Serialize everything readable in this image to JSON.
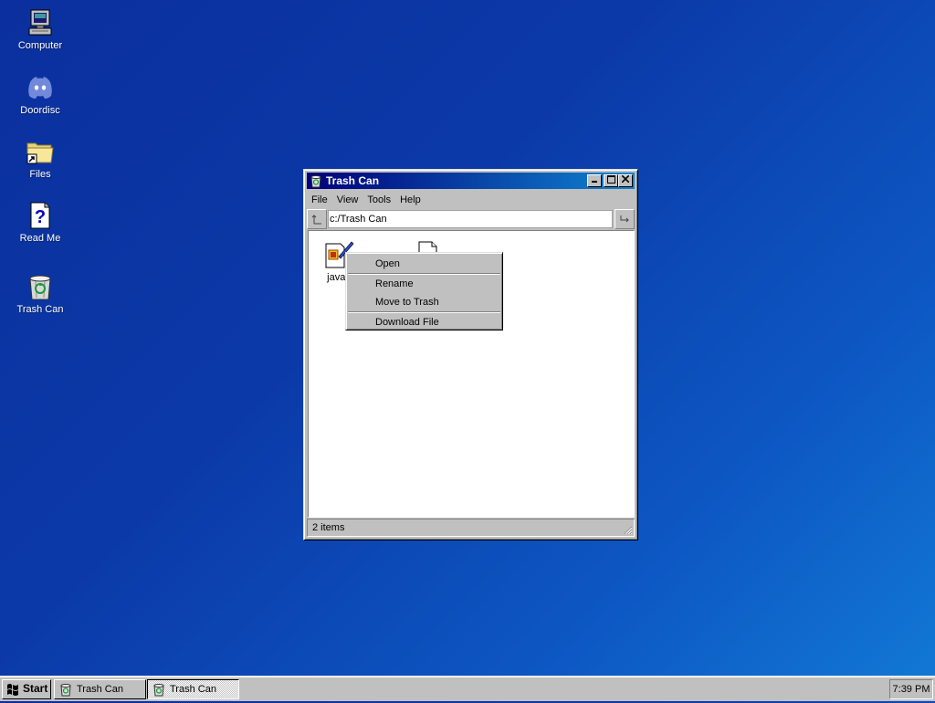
{
  "desktop": {
    "icons": [
      {
        "label": "Computer",
        "icon": "computer-icon"
      },
      {
        "label": "Doordisc",
        "icon": "discord-icon"
      },
      {
        "label": "Files",
        "icon": "folder-shortcut-icon"
      },
      {
        "label": "Read Me",
        "icon": "help-document-icon"
      },
      {
        "label": "Trash Can",
        "icon": "trash-can-icon"
      }
    ]
  },
  "window": {
    "title": "Trash Can",
    "title_icon": "trash-can-icon",
    "controls": {
      "minimize": "minimize-icon",
      "maximize": "maximize-icon",
      "close": "close-icon"
    },
    "menu": [
      "File",
      "View",
      "Tools",
      "Help"
    ],
    "address": {
      "value": "c:/Trash Can",
      "up_icon": "up-folder-icon",
      "go_icon": "go-arrow-icon"
    },
    "files": [
      {
        "label": "javas",
        "icon": "javascript-file-icon"
      },
      {
        "label": "",
        "icon": "blank-document-icon"
      }
    ],
    "status": "2 items"
  },
  "context_menu": {
    "items": [
      "Open",
      "Rename",
      "Move to Trash",
      "Download File"
    ]
  },
  "taskbar": {
    "start_label": "Start",
    "tasks": [
      {
        "label": "Trash Can",
        "active": false
      },
      {
        "label": "Trash Can",
        "active": true
      }
    ],
    "clock": "7:39 PM"
  },
  "colors": {
    "desktop": "#0b3aa8",
    "title_active_start": "#00007b",
    "title_active_end": "#1084d0",
    "chrome": "#c0c0c0"
  }
}
